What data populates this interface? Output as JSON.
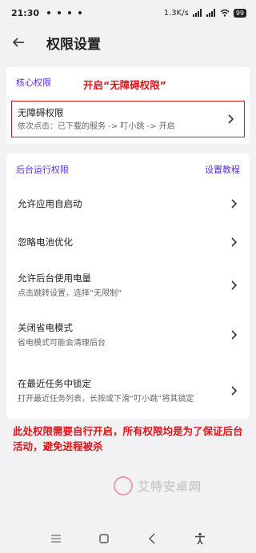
{
  "status_bar": {
    "time": "21:30",
    "network_speed": "1.3K/s",
    "battery": "99",
    "icons": [
      "signal-icon",
      "signal-icon",
      "wifi-icon",
      "battery-icon"
    ]
  },
  "app_bar": {
    "back_icon": "arrow-left-icon",
    "title": "权限设置"
  },
  "core_section": {
    "title": "核心权限",
    "annotation": "开启“无障碍权限”",
    "accessibility": {
      "title": "无障碍权限",
      "subtitle": "依次点击：已下载的服务 -> 叮小跳 -> 开启"
    }
  },
  "background_section": {
    "title": "后台运行权限",
    "tutorial_link": "设置教程",
    "items": [
      {
        "title": "允许应用自启动",
        "subtitle": ""
      },
      {
        "title": "忽略电池优化",
        "subtitle": ""
      },
      {
        "title": "允许后台使用电量",
        "subtitle": "点击跳转设置，选择”无限制”"
      },
      {
        "title": "关闭省电模式",
        "subtitle": "省电模式可能会清理后台"
      },
      {
        "title": "在最近任务中锁定",
        "subtitle": "打开最近任务列表，长按或下滑“叮小跳”将其锁定"
      }
    ]
  },
  "bottom_annotation": "此处权限需要自行开启，所有权限均是为了保证后台活动，避免进程被杀",
  "watermark": "艾特安卓网",
  "nav_bar": {
    "icons": [
      "menu-icon",
      "home-square-icon",
      "back-triangle-icon",
      "accessibility-icon"
    ]
  },
  "colors": {
    "accent": "#5a2fcf",
    "annotation_red": "#e0131a",
    "background": "#f2f2f4"
  }
}
